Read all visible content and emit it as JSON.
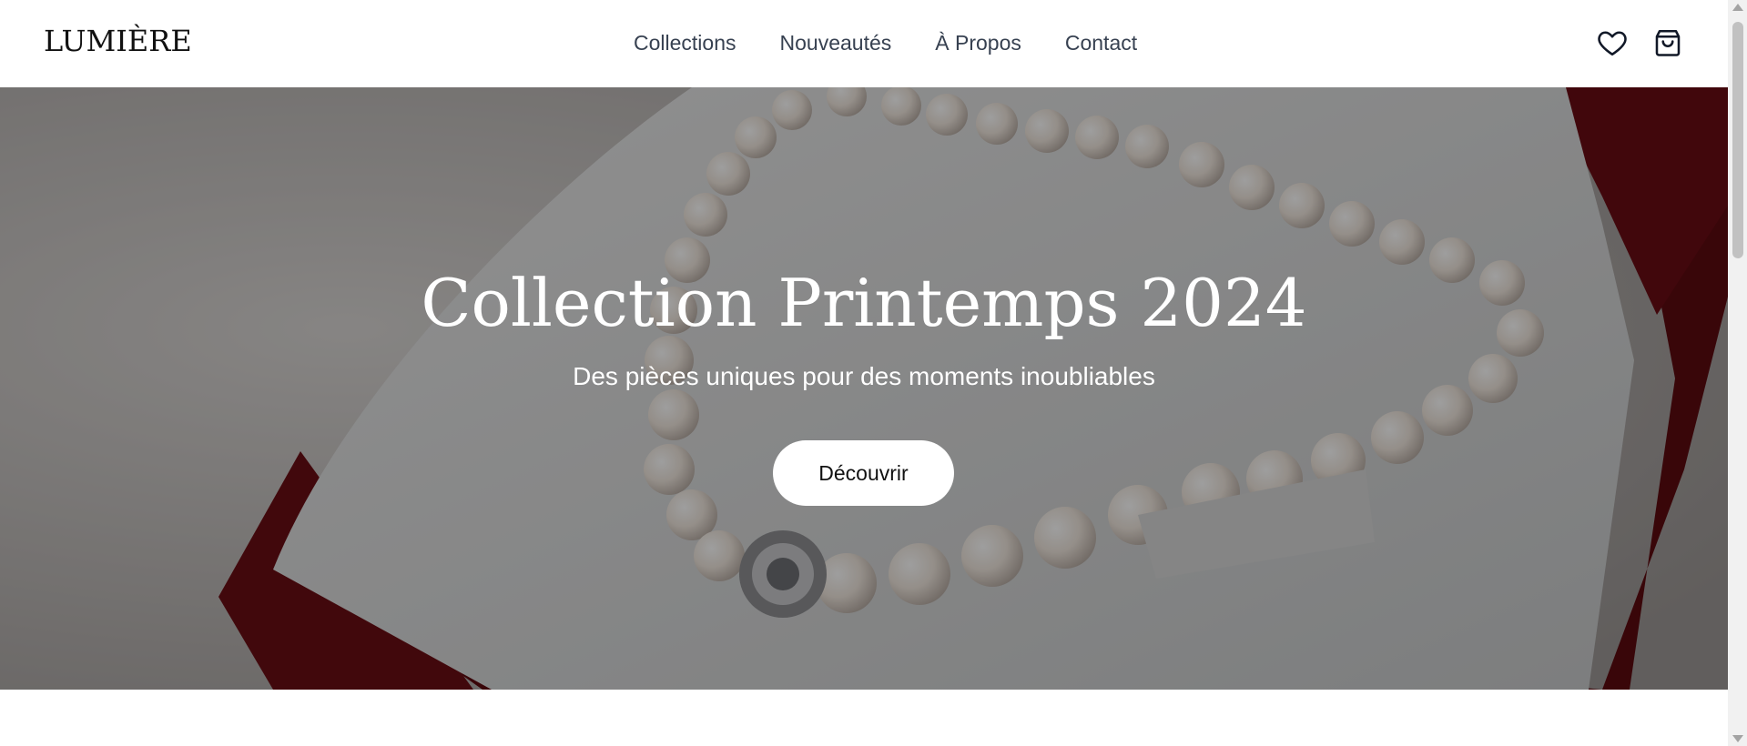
{
  "header": {
    "logo": "LUMIÈRE",
    "nav": [
      "Collections",
      "Nouveautés",
      "À Propos",
      "Contact"
    ],
    "icons": [
      "heart-icon",
      "shopping-bag-icon"
    ]
  },
  "hero": {
    "title": "Collection Printemps 2024",
    "subtitle": "Des pièces uniques pour des moments inoubliables",
    "cta": "Découvrir",
    "image": "pearl-necklace-in-red-box",
    "colors": {
      "overlay": "#000000",
      "box": "#7a1016",
      "pearls": "#ece4dc"
    }
  }
}
